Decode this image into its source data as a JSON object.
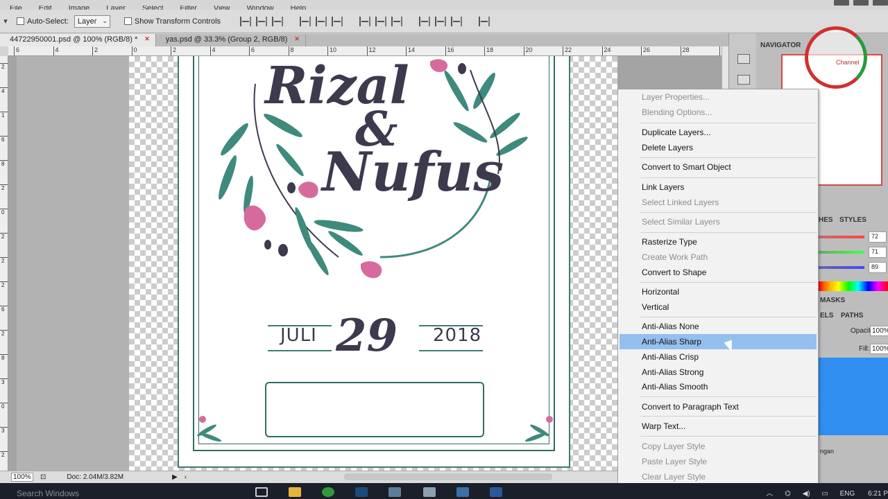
{
  "menubar": {
    "items": [
      "File",
      "Edit",
      "Image",
      "Layer",
      "Select",
      "Filter",
      "View",
      "Window",
      "Help"
    ]
  },
  "options": {
    "auto_select_label": "Auto-Select:",
    "auto_select_value": "Layer",
    "show_transform_label": "Show Transform Controls"
  },
  "tabs": [
    {
      "label": "44722950001.psd @ 100% (RGB/8) *"
    },
    {
      "label": "yas.psd @ 33.3% (Group 2, RGB/8)"
    }
  ],
  "ruler_h": [
    "6",
    "4",
    "2",
    "0",
    "2",
    "4",
    "6",
    "8",
    "10",
    "12",
    "14",
    "16",
    "18",
    "20",
    "22",
    "24",
    "26",
    "28",
    "30"
  ],
  "ruler_v": [
    "2",
    "4",
    "1",
    "6",
    "8",
    "2",
    "0",
    "2",
    "2",
    "2",
    "6",
    "2",
    "8",
    "3",
    "0",
    "3",
    "2"
  ],
  "card": {
    "name1": "Rizal",
    "amp": "&",
    "name2": "Nufus",
    "month": "JULI",
    "day": "29",
    "year": "2018"
  },
  "status": {
    "zoom": "100%",
    "doc": "Doc: 2.04M/3.82M"
  },
  "panel": {
    "navigator_title": "NAVIGATOR",
    "tab_swatches": "HES",
    "tab_styles": "STYLES",
    "color_r": "72",
    "color_g": "71",
    "color_b": "89",
    "masks_tab": "MASKS",
    "channels_tab": "ELS",
    "paths_tab": "PATHS",
    "opacity_label": "Opacity:",
    "opacity_value": "100%",
    "fill_label": "Fill:",
    "fill_value": "100%",
    "layer_name": "ngan"
  },
  "logo": {
    "text": "Channel"
  },
  "context_menu": {
    "items": [
      {
        "label": "Layer Properties...",
        "disabled": true
      },
      {
        "label": "Blending Options...",
        "disabled": true
      },
      {
        "label": "Duplicate Layers...",
        "disabled": false
      },
      {
        "label": "Delete Layers",
        "disabled": false
      },
      {
        "label": "Convert to Smart Object",
        "disabled": false
      },
      {
        "label": "Link Layers",
        "disabled": false
      },
      {
        "label": "Select Linked Layers",
        "disabled": true
      },
      {
        "label": "Select Similar Layers",
        "disabled": true
      },
      {
        "label": "Rasterize Type",
        "disabled": false
      },
      {
        "label": "Create Work Path",
        "disabled": true
      },
      {
        "label": "Convert to Shape",
        "disabled": false
      },
      {
        "label": "Horizontal",
        "disabled": false
      },
      {
        "label": "Vertical",
        "disabled": false
      },
      {
        "label": "Anti-Alias None",
        "disabled": false
      },
      {
        "label": "Anti-Alias Sharp",
        "disabled": false,
        "highlighted": true
      },
      {
        "label": "Anti-Alias Crisp",
        "disabled": false
      },
      {
        "label": "Anti-Alias Strong",
        "disabled": false
      },
      {
        "label": "Anti-Alias Smooth",
        "disabled": false
      },
      {
        "label": "Convert to Paragraph Text",
        "disabled": false
      },
      {
        "label": "Warp Text...",
        "disabled": false
      },
      {
        "label": "Copy Layer Style",
        "disabled": true
      },
      {
        "label": "Paste Layer Style",
        "disabled": true
      },
      {
        "label": "Clear Layer Style",
        "disabled": true
      }
    ]
  },
  "taskbar": {
    "search_placeholder": "Search Windows",
    "lang": "ENG",
    "time": "6:21 P"
  },
  "colors": {
    "teal": "#2f6c62",
    "ink": "#3d3a4e",
    "pink": "#d76a9c",
    "highlight": "#93c0ef"
  }
}
